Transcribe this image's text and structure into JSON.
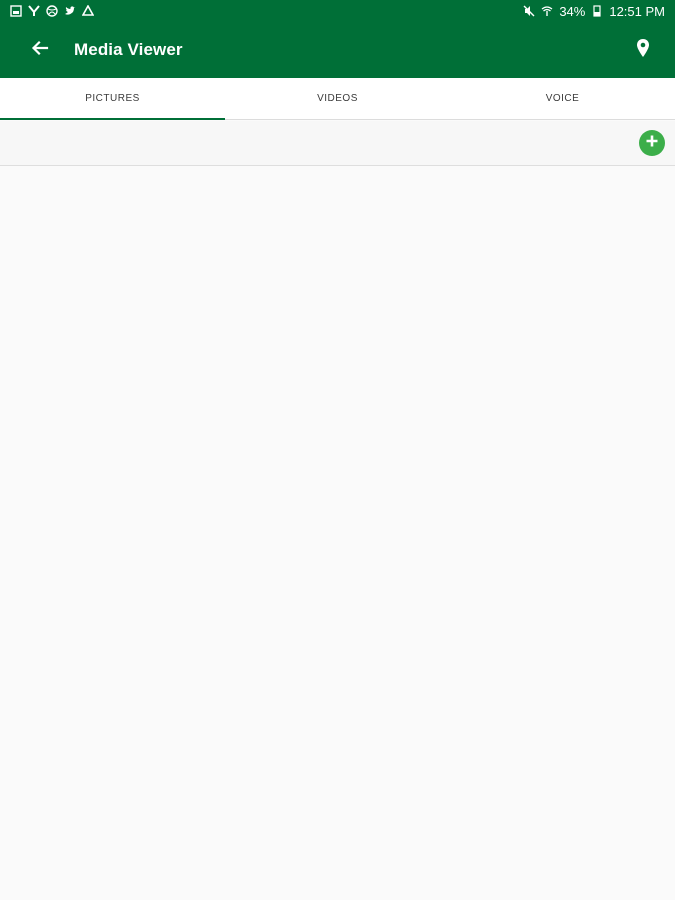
{
  "status_bar": {
    "battery": "34%",
    "time": "12:51 PM",
    "left_icons": [
      "gallery-icon",
      "yammer-icon",
      "dribbble-icon",
      "twitter-icon",
      "drive-icon"
    ],
    "right_icons": [
      "mute-icon",
      "wifi-icon",
      "battery-icon"
    ]
  },
  "app_bar": {
    "title": "Media Viewer",
    "back_icon": "arrow-left-icon",
    "location_icon": "map-pin-icon",
    "color": "#006f37"
  },
  "tabs": [
    {
      "label": "PICTURES",
      "active": true
    },
    {
      "label": "VIDEOS",
      "active": false
    },
    {
      "label": "VOICE",
      "active": false
    }
  ],
  "toolbar": {
    "add_icon": "plus-circle-icon",
    "add_color": "#3cae4a"
  }
}
